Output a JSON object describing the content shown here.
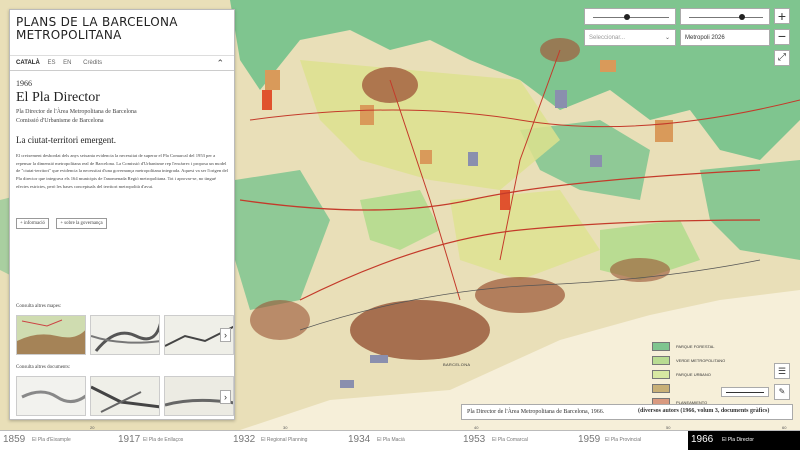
{
  "panel": {
    "title": "PLANS DE LA BARCELONA METROPOLITANA",
    "languages": [
      "CATALÀ",
      "ES",
      "EN"
    ],
    "credits": "Crèdits",
    "year": "1966",
    "plan_title": "El Pla Director",
    "subtitle_1": "Pla Director de l'Àrea Metropolitana de Barcelona",
    "subtitle_2": "Comissió d'Urbanisme de Barcelona",
    "section_title": "La ciutat-territori emergent.",
    "body": "El creixement desbordat dels anys seixanta evidencia la necessitat de superar el Pla Comarcal del 1953 per a repensar la dimensió metropolitana real de Barcelona. La Comissió d'Urbanisme rep l'encàrrec i proposa un model de \"ciutat-territori\" que evidencia la necessitat d'una governança metropolitana integrada. Aquest va ser l'origen del Pla director que integrava els 164 municipis de l'anomenada Regió metropolitana. Tot i aprovar-se, no tingué efectes estrictes, però les bases conceptuals del territori metropolità d'avui.",
    "buttons": [
      "+ informació",
      "+ sobre la governança"
    ],
    "consult_maps": "Consulta altres mapes:",
    "consult_docs": "Consulta altres documents:"
  },
  "controls": {
    "select_left": "Seleccionar...",
    "select_right": "Metropoli 2026",
    "zoom_in": "+",
    "zoom_out": "−",
    "fullscreen": "⤢",
    "list": "☰",
    "edit": "✎",
    "slider_left": 0.45,
    "slider_right": 0.72
  },
  "legend": [
    {
      "label": "PARQUE FORESTAL",
      "color": "#7fc58f"
    },
    {
      "label": "VERDE METROPOLITANO",
      "color": "#b9dc92"
    },
    {
      "label": "PARQUE URBANO",
      "color": "#d7e8a2"
    },
    {
      "label": "",
      "color": "#c8b077"
    },
    {
      "label": "PLANEAMIENTO",
      "color": "#d99a80"
    }
  ],
  "map_labels": {
    "city": "BARCELONA"
  },
  "caption": {
    "text": "Pla Director de l'Àrea Metropolitana de Barcelona, 1966.",
    "author": "(diversos autors (1966, volum 3, documents gràfics)"
  },
  "ticks": [
    "20",
    "30",
    "40",
    "50",
    "60"
  ],
  "timeline": [
    {
      "year": "1859",
      "name": "El Pla d'Eixample"
    },
    {
      "year": "1917",
      "name": "El Pla de Enllaços"
    },
    {
      "year": "1932",
      "name": "El Regional Planning"
    },
    {
      "year": "1934",
      "name": "El Pla Macià"
    },
    {
      "year": "1953",
      "name": "El Pla Comarcal"
    },
    {
      "year": "1959",
      "name": "El Pla Provincial"
    },
    {
      "year": "1966",
      "name": "El Pla Director"
    }
  ]
}
